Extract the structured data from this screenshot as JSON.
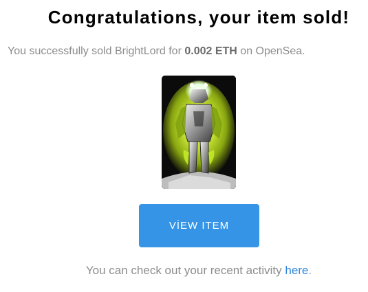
{
  "headline": "Congratulations, your item sold!",
  "message": {
    "prefix": "You successfully sold",
    "item_name": "BrightLord",
    "middle": "for",
    "price": "0.002 ETH",
    "suffix": "on OpenSea."
  },
  "nft_image": {
    "alt": "BrightLord"
  },
  "button": {
    "label": "VİEW ITEM"
  },
  "footer": {
    "text": "You can check out your recent activity",
    "link_text": "here",
    "end": "."
  },
  "colors": {
    "button_bg": "#3594e6",
    "link": "#2f86d9",
    "muted_text": "#8c8c8c",
    "glow": "#c8f02a"
  }
}
